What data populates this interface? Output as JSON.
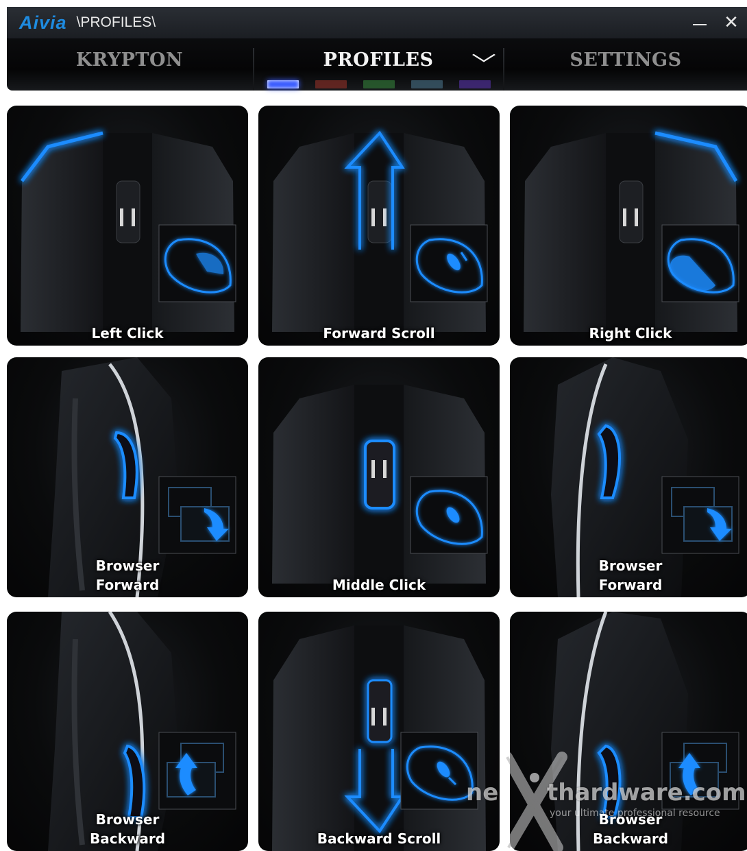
{
  "window": {
    "logo": "Aivia",
    "path": "\\PROFILES\\",
    "minimize_icon": "minimize-icon",
    "close_label": "✕"
  },
  "nav": {
    "tabs": [
      {
        "label": "KRYPTON",
        "active": false
      },
      {
        "label": "PROFILES",
        "active": true
      },
      {
        "label": "SETTINGS",
        "active": false
      }
    ],
    "dropdown_icon": "chevron-down-icon",
    "profile_colors": [
      "#3a5cff",
      "#7a2b24",
      "#2d6b33",
      "#3d5f72",
      "#4a2c8c"
    ],
    "selected_profile": 1
  },
  "tiles": [
    {
      "label": "Left Click",
      "icon": "left-click-icon"
    },
    {
      "label": "Forward Scroll",
      "icon": "scroll-up-icon"
    },
    {
      "label": "Right Click",
      "icon": "right-click-icon"
    },
    {
      "label": "Browser\nForward",
      "icon": "browser-forward-icon"
    },
    {
      "label": "Middle Click",
      "icon": "middle-click-icon"
    },
    {
      "label": "Browser\nForward",
      "icon": "browser-forward-icon"
    },
    {
      "label": "Browser\nBackward",
      "icon": "browser-backward-icon"
    },
    {
      "label": "Backward Scroll",
      "icon": "scroll-down-icon"
    },
    {
      "label": "Browser\nBackward",
      "icon": "browser-backward-icon"
    }
  ],
  "watermark": {
    "left": "ne",
    "right": "thardware.com",
    "tagline": "your ultimate professional resource"
  },
  "colors": {
    "accent": "#1e8be0",
    "glow": "#1a8cff",
    "background": "#ffffff"
  }
}
